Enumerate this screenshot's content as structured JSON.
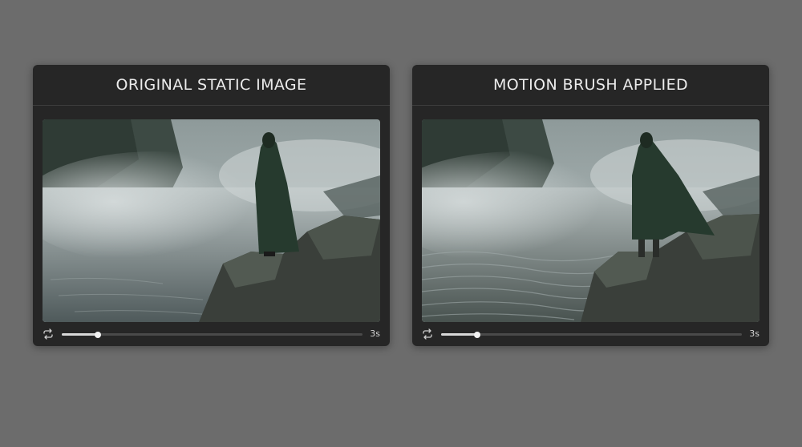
{
  "panels": [
    {
      "title": "ORIGINAL STATIC IMAGE",
      "media_alt_icon": "cloaked-figure-on-cliff-image",
      "player": {
        "loop_icon": "loop-icon",
        "progress_percent": 12,
        "duration": "3s"
      }
    },
    {
      "title": "MOTION BRUSH APPLIED",
      "media_alt_icon": "cloaked-figure-on-cliff-image",
      "player": {
        "loop_icon": "loop-icon",
        "progress_percent": 12,
        "duration": "3s"
      }
    }
  ],
  "colors": {
    "background": "#6c6c6c",
    "panel": "#262626",
    "track": "#4a4a4a",
    "track_fill": "#d9d9d9",
    "header_text": "#ececec"
  }
}
